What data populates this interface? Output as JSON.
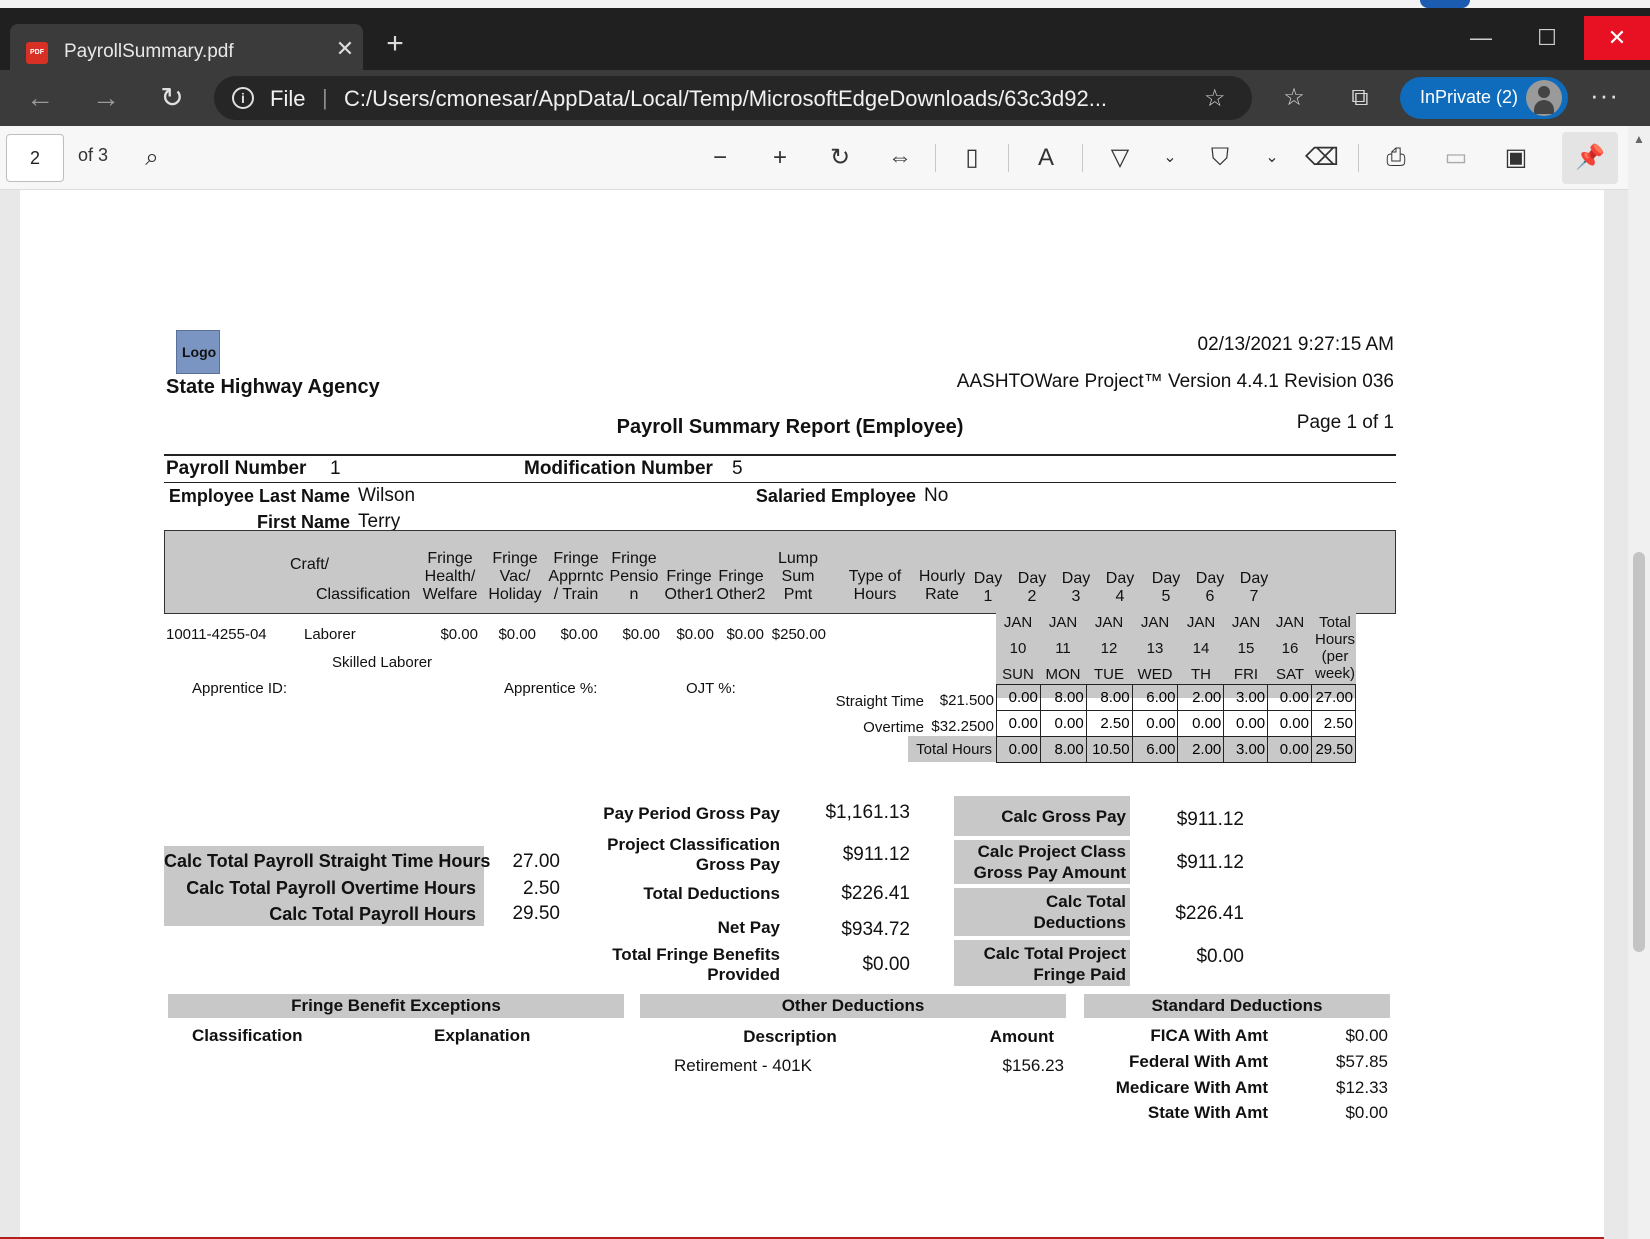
{
  "browser": {
    "tab_title": "PayrollSummary.pdf",
    "pdf_icon_text": "PDF",
    "url_scheme_label": "File",
    "url": "C:/Users/cmonesar/AppData/Local/Temp/MicrosoftEdgeDownloads/63c3d92...",
    "inprivate_label": "InPrivate (2)"
  },
  "pdf_toolbar": {
    "page_number": "2",
    "page_of": "of 3"
  },
  "report": {
    "logo": "Logo",
    "agency": "State Highway Agency",
    "timestamp": "02/13/2021 9:27:15 AM",
    "product": "AASHTOWare Project™ Version 4.4.1 Revision 036",
    "title": "Payroll Summary Report (Employee)",
    "page": "Page 1 of 1",
    "payroll_number_label": "Payroll Number",
    "payroll_number": "1",
    "modification_number_label": "Modification Number",
    "modification_number": "5",
    "last_name_label": "Employee Last Name",
    "last_name": "Wilson",
    "first_name_label": "First Name",
    "first_name": "Terry",
    "salaried_label": "Salaried Employee",
    "salaried": "No",
    "headers": {
      "craft": "Craft/",
      "classification": "Classification",
      "fringe_health_1": "Fringe",
      "fringe_health_2": "Health/",
      "fringe_health_3": "Welfare",
      "fringe_vac_1": "Fringe",
      "fringe_vac_2": "Vac/",
      "fringe_vac_3": "Holiday",
      "fringe_appr_1": "Fringe",
      "fringe_appr_2": "Apprntc",
      "fringe_appr_3": "/ Train",
      "fringe_pens_1": "Fringe",
      "fringe_pens_2": "Pensio",
      "fringe_pens_3": "n",
      "fringe_o1_1": "Fringe",
      "fringe_o1_2": "Other1",
      "fringe_o2_1": "Fringe",
      "fringe_o2_2": "Other2",
      "lump_1": "Lump",
      "lump_2": "Sum",
      "lump_3": "Pmt",
      "type_1": "Type of",
      "type_2": "Hours",
      "rate_1": "Hourly",
      "rate_2": "Rate",
      "day1_1": "Day",
      "day1_2": "1",
      "day2_1": "Day",
      "day2_2": "2",
      "day3_1": "Day",
      "day3_2": "3",
      "day4_1": "Day",
      "day4_2": "4",
      "day5_1": "Day",
      "day5_2": "5",
      "day6_1": "Day",
      "day6_2": "6",
      "day7_1": "Day",
      "day7_2": "7"
    },
    "row": {
      "id": "10011-4255-04",
      "craft": "Laborer",
      "classification": "Skilled Laborer",
      "health": "$0.00",
      "vac": "$0.00",
      "appr": "$0.00",
      "pension": "$0.00",
      "other1": "$0.00",
      "other2": "$0.00",
      "lump": "$250.00",
      "apprentice_id_label": "Apprentice ID:",
      "apprentice_pct_label": "Apprentice %:",
      "ojt_pct_label": "OJT %:"
    },
    "days": {
      "months": [
        "JAN",
        "JAN",
        "JAN",
        "JAN",
        "JAN",
        "JAN",
        "JAN"
      ],
      "dates": [
        "10",
        "11",
        "12",
        "13",
        "14",
        "15",
        "16"
      ],
      "weekdays": [
        "SUN",
        "MON",
        "TUE",
        "WED",
        "TH",
        "FRI",
        "SAT"
      ],
      "total_1": "Total",
      "total_2": "Hours",
      "total_3": "(per",
      "total_4": "week)"
    },
    "hours": [
      {
        "type": "Straight Time",
        "rate": "$21.500",
        "values": [
          "0.00",
          "8.00",
          "8.00",
          "6.00",
          "2.00",
          "3.00",
          "0.00"
        ],
        "total": "27.00"
      },
      {
        "type": "Overtime",
        "rate": "$32.2500",
        "values": [
          "0.00",
          "0.00",
          "2.50",
          "0.00",
          "0.00",
          "0.00",
          "0.00"
        ],
        "total": "2.50"
      },
      {
        "type": "Total Hours",
        "rate": "",
        "values": [
          "0.00",
          "8.00",
          "10.50",
          "6.00",
          "2.00",
          "3.00",
          "0.00"
        ],
        "total": "29.50"
      }
    ],
    "calc_hours": {
      "st_label": "Calc Total Payroll Straight Time Hours",
      "st": "27.00",
      "ot_label": "Calc Total Payroll Overtime Hours",
      "ot": "2.50",
      "total_label": "Calc Total Payroll Hours",
      "total": "29.50"
    },
    "pay": {
      "gross_label": "Pay Period Gross Pay",
      "gross": "$1,161.13",
      "pc_gross_label_1": "Project Classification",
      "pc_gross_label_2": "Gross Pay",
      "pc_gross": "$911.12",
      "deductions_label": "Total Deductions",
      "deductions": "$226.41",
      "net_label": "Net Pay",
      "net": "$934.72",
      "fringe_label_1": "Total Fringe Benefits",
      "fringe_label_2": "Provided",
      "fringe": "$0.00"
    },
    "calc_pay": {
      "gross_label": "Calc Gross Pay",
      "gross": "$911.12",
      "pc_label_1": "Calc Project Class",
      "pc_label_2": "Gross Pay Amount",
      "pc": "$911.12",
      "ded_label_1": "Calc Total",
      "ded_label_2": "Deductions",
      "ded": "$226.41",
      "fringe_label_1": "Calc Total Project",
      "fringe_label_2": "Fringe Paid",
      "fringe": "$0.00"
    },
    "fringe_exceptions": {
      "title": "Fringe Benefit Exceptions",
      "col1": "Classification",
      "col2": "Explanation"
    },
    "other_deductions": {
      "title": "Other Deductions",
      "col1": "Description",
      "col2": "Amount",
      "rows": [
        {
          "description": "Retirement - 401K",
          "amount": "$156.23"
        }
      ]
    },
    "standard_deductions": {
      "title": "Standard Deductions",
      "rows": [
        {
          "label": "FICA With Amt",
          "value": "$0.00"
        },
        {
          "label": "Federal With Amt",
          "value": "$57.85"
        },
        {
          "label": "Medicare With Amt",
          "value": "$12.33"
        },
        {
          "label": "State With Amt",
          "value": "$0.00"
        }
      ]
    }
  }
}
